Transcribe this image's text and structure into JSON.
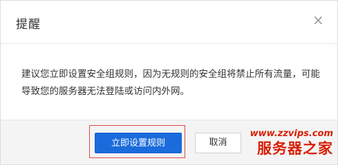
{
  "dialog": {
    "title": "提醒",
    "close_symbol": "×",
    "message": "建议您立即设置安全组规则，因为无规则的安全组将禁止所有流量，可能导致您的服务器无法登陆或访问内外网。",
    "primary_button": "立即设置规则",
    "cancel_button": "取消"
  },
  "watermark": {
    "url": "www.zzvips.com",
    "text": "服务器之家"
  },
  "colors": {
    "primary": "#1a6bdc",
    "highlight": "#e0484a",
    "watermark": "#d81e06"
  }
}
